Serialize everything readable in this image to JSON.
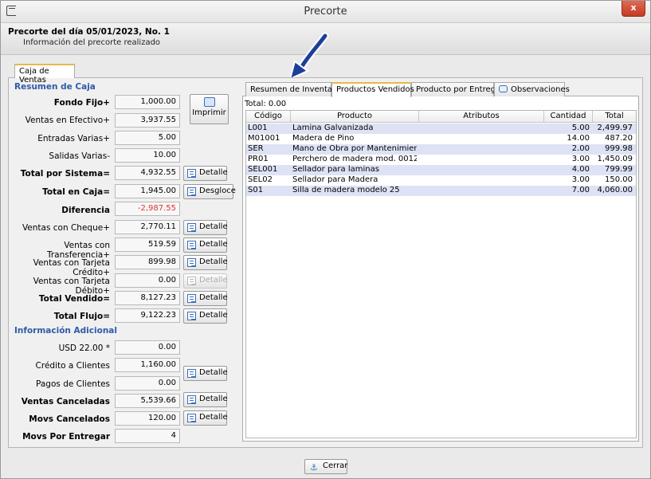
{
  "window": {
    "title": "Precorte",
    "close_label": "x"
  },
  "header": {
    "title": "Precorte del día 05/01/2023, No. 1",
    "subtitle": "Información del precorte realizado"
  },
  "outer_tab": "Caja de Ventas",
  "resumen": {
    "title": "Resumen de Caja",
    "rows": [
      {
        "label": "Fondo Fijo+",
        "value": "1,000.00",
        "bold": true
      },
      {
        "label": "Ventas en Efectivo+",
        "value": "3,937.55"
      },
      {
        "label": "Entradas Varias+",
        "value": "5.00"
      },
      {
        "label": "Salidas Varias-",
        "value": "10.00"
      },
      {
        "label": "Total por Sistema=",
        "value": "4,932.55",
        "bold": true
      },
      {
        "label": "Total en Caja=",
        "value": "1,945.00",
        "bold": true
      },
      {
        "label": "Diferencia",
        "value": "-2,987.55",
        "bold": true
      },
      {
        "label": "Ventas con Cheque+",
        "value": "2,770.11"
      },
      {
        "label": "Ventas con Transferencia+",
        "value": "519.59"
      },
      {
        "label": "Ventas con Tarjeta Crédito+",
        "value": "899.98"
      },
      {
        "label": "Ventas con Tarjeta Débito+",
        "value": "0.00"
      },
      {
        "label": "Total Vendido=",
        "value": "8,127.23",
        "bold": true
      },
      {
        "label": "Total Flujo=",
        "value": "9,122.23",
        "bold": true
      }
    ]
  },
  "adicional": {
    "title": "Información Adicional",
    "rows": [
      {
        "label": "USD 22.00 *",
        "value": "0.00"
      },
      {
        "label": "Crédito a Clientes",
        "value": "1,160.00"
      },
      {
        "label": "Pagos de Clientes",
        "value": "0.00"
      },
      {
        "label": "Ventas Canceladas",
        "value": "5,539.66",
        "bold": true
      },
      {
        "label": "Movs Cancelados",
        "value": "120.00",
        "bold": true
      },
      {
        "label": "Movs Por Entregar",
        "value": "4",
        "bold": true
      }
    ]
  },
  "buttons": {
    "imprimir": "Imprimir",
    "detalle": "Detalle",
    "desgloce": "Desgloce",
    "cerrar": "Cerrar"
  },
  "tabs": [
    "Resumen de Inventario",
    "Productos Vendidos",
    "Producto por Entregar",
    "Observaciones"
  ],
  "total_line": "Total: 0.00",
  "table": {
    "columns": [
      "Código",
      "Producto",
      "Atributos",
      "Cantidad",
      "Total"
    ],
    "rows": [
      [
        "L001",
        "Lamina Galvanizada",
        "",
        "5.00",
        "2,499.97"
      ],
      [
        "M01001",
        "Madera de Pino",
        "",
        "14.00",
        "487.20"
      ],
      [
        "SER",
        "Mano de Obra por Mantenimiento",
        "",
        "2.00",
        "999.98"
      ],
      [
        "PR01",
        "Perchero de madera mod. 00125",
        "",
        "3.00",
        "1,450.09"
      ],
      [
        "SEL001",
        "Sellador para laminas",
        "",
        "4.00",
        "799.99"
      ],
      [
        "SEL02",
        "Sellador para Madera",
        "",
        "3.00",
        "150.00"
      ],
      [
        "S01",
        "Silla de madera modelo 25",
        "",
        "7.00",
        "4,060.00"
      ]
    ]
  },
  "colors": {
    "accent_blue": "#2f5aa8",
    "negative": "#e0342c",
    "tab_highlight": "#e8b84a",
    "row_alt": "#dde3f5",
    "close_red": "#c23b22"
  }
}
